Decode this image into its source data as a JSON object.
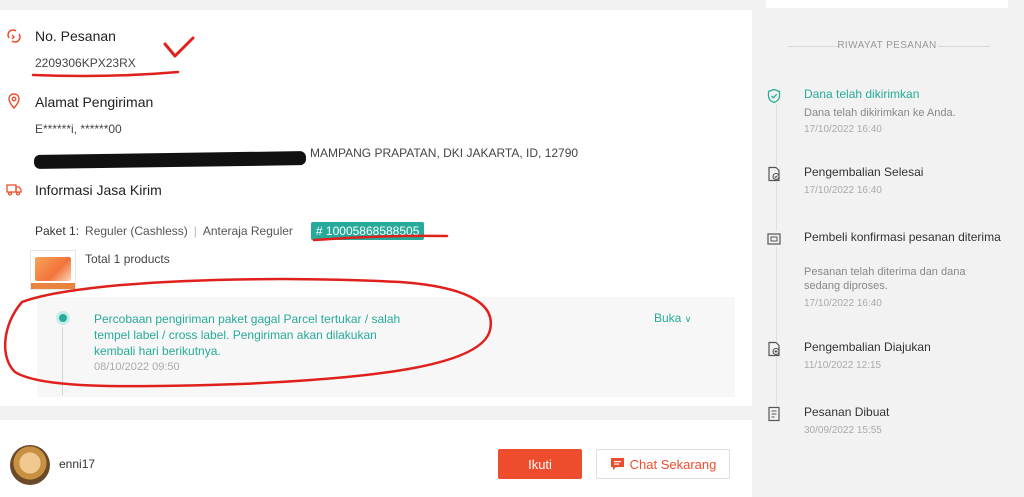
{
  "order": {
    "title": "No. Pesanan",
    "number": "2209306KPX23RX"
  },
  "address": {
    "title": "Alamat Pengiriman",
    "name_phone": "E******i, ******00",
    "address_visible": "MAMPANG PRAPATAN, DKI JAKARTA, ID, 12790"
  },
  "shipping": {
    "title": "Informasi Jasa Kirim",
    "package_label": "Paket 1:",
    "service": "Reguler (Cashless)",
    "courier": "Anteraja Reguler",
    "tracking_number": "# 10005868588505",
    "total_products": "Total 1 products"
  },
  "tracking": {
    "message": "Percobaan pengiriman paket gagal Parcel tertukar / salah tempel label / cross label. Pengiriman akan dilakukan kembali hari berikutnya.",
    "time": "08/10/2022 09:50",
    "expand_label": "Buka"
  },
  "seller": {
    "name": "enni17",
    "follow_label": "Ikuti",
    "chat_label": "Chat Sekarang"
  },
  "history": {
    "header": "RIWAYAT PESANAN",
    "items": [
      {
        "title": "Dana telah dikirimkan",
        "desc": "Dana telah dikirimkan ke Anda.",
        "time": "17/10/2022 16:40",
        "icon": "shield-check-icon",
        "active": true
      },
      {
        "title": "Pengembalian Selesai",
        "desc": "",
        "time": "17/10/2022 16:40",
        "icon": "return-done-icon",
        "active": false
      },
      {
        "title": "Pembeli konfirmasi pesanan diterima",
        "desc": "Pesanan telah diterima dan dana sedang diproses.",
        "time": "17/10/2022 16:40",
        "icon": "package-received-icon",
        "active": false
      },
      {
        "title": "Pengembalian Diajukan",
        "desc": "",
        "time": "11/10/2022 12:15",
        "icon": "return-request-icon",
        "active": false
      },
      {
        "title": "Pesanan Dibuat",
        "desc": "",
        "time": "30/09/2022 15:55",
        "icon": "receipt-icon",
        "active": false
      }
    ]
  },
  "colors": {
    "accent_green": "#26aa99",
    "accent_orange": "#ee4d2d",
    "annotation_red": "#e0201c"
  }
}
